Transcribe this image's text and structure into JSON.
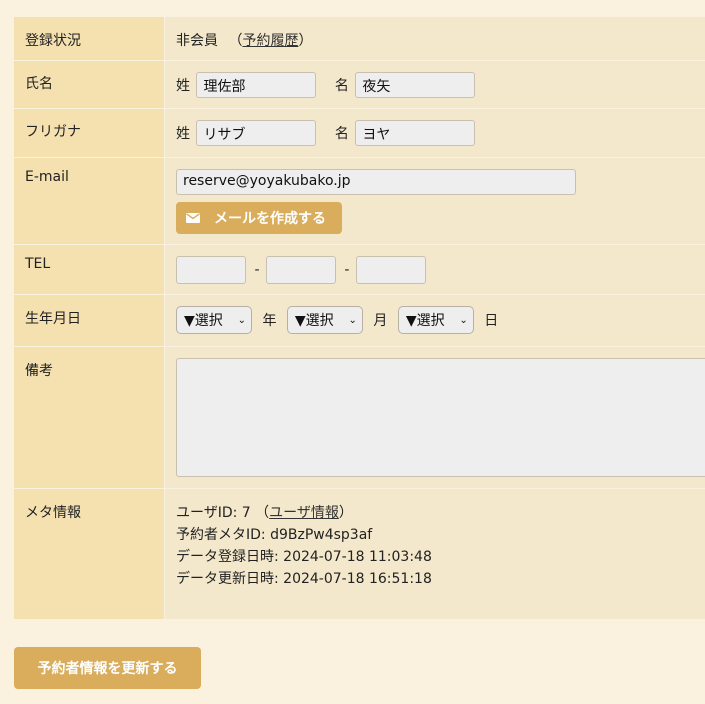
{
  "status": {
    "label": "登録状況",
    "value": "非会員",
    "paren_open": "（",
    "link": "予約履歴",
    "paren_close": "）"
  },
  "name": {
    "label": "氏名",
    "sei_label": "姓",
    "sei_value": "理佐部",
    "mei_label": "名",
    "mei_value": "夜矢"
  },
  "furigana": {
    "label": "フリガナ",
    "sei_label": "姓",
    "sei_value": "リサブ",
    "mei_label": "名",
    "mei_value": "ヨヤ"
  },
  "email": {
    "label": "E-mail",
    "value": "reserve@yoyakubako.jp",
    "button": "メールを作成する"
  },
  "tel": {
    "label": "TEL",
    "sep": "-",
    "part1": "",
    "part2": "",
    "part3": ""
  },
  "birthday": {
    "label": "生年月日",
    "year_select": "▼選択",
    "year_unit": "年",
    "month_select": "▼選択",
    "month_unit": "月",
    "day_select": "▼選択",
    "day_unit": "日"
  },
  "notes": {
    "label": "備考",
    "value": ""
  },
  "meta": {
    "label": "メタ情報",
    "user_id_prefix": "ユーザID: 7 （",
    "user_link": "ユーザ情報",
    "user_id_suffix": "）",
    "reserver_meta": "予約者メタID: d9BzPw4sp3af",
    "created": "データ登録日時: 2024-07-18 11:03:48",
    "updated": "データ更新日時: 2024-07-18 16:51:18"
  },
  "submit_button": "予約者情報を更新する",
  "colors": {
    "accent": "#d9ad5c",
    "label_bg": "#f5e1b0",
    "value_bg": "#f4e8cc",
    "page_bg": "#fbf1df"
  }
}
